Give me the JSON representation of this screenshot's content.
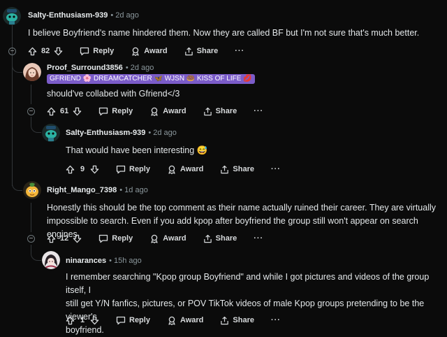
{
  "comments": [
    {
      "username": "Salty-Enthusiasm-939",
      "time": "2d ago",
      "text": "I believe Boyfriend's name hindered them. Now they are called BF but I'm not sure that's much better.",
      "votes": "82"
    },
    {
      "username": "Proof_Surround3856",
      "time": "2d ago",
      "flair": "GFRIEND 🌸 DREAMCATCHER 🦋 WJSN 🍩 KISS OF LIFE 💋",
      "text": "should've collabed with Gfriend</3",
      "votes": "61"
    },
    {
      "username": "Salty-Enthusiasm-939",
      "time": "2d ago",
      "text": "That would have been interesting 😅",
      "votes": "9"
    },
    {
      "username": "Right_Mango_7398",
      "time": "1d ago",
      "text_lines": [
        "Honestly this should be the top comment as their name actually ruined their career. They are virtually",
        "impossible to search. Even if you add kpop after boyfriend the group still won't appear on search engines."
      ],
      "votes": "12"
    },
    {
      "username": "ninarances",
      "time": "15h ago",
      "text_lines": [
        "I remember searching \"Kpop group Boyfriend\" and while I got pictures and videos of the group itself, I",
        "still get Y/N fanfics, pictures, or POV TikTok videos of male Kpop groups pretending to be the viewer's",
        "boyfriend."
      ],
      "votes": "1"
    }
  ],
  "actions": {
    "reply": "Reply",
    "award": "Award",
    "share": "Share",
    "more": "···",
    "collapse": "−"
  },
  "colors": {
    "background": "#0b0b0b",
    "thread_line": "#323639",
    "flair_bg": "#7b5cc9",
    "muted_text": "#8b979c"
  }
}
